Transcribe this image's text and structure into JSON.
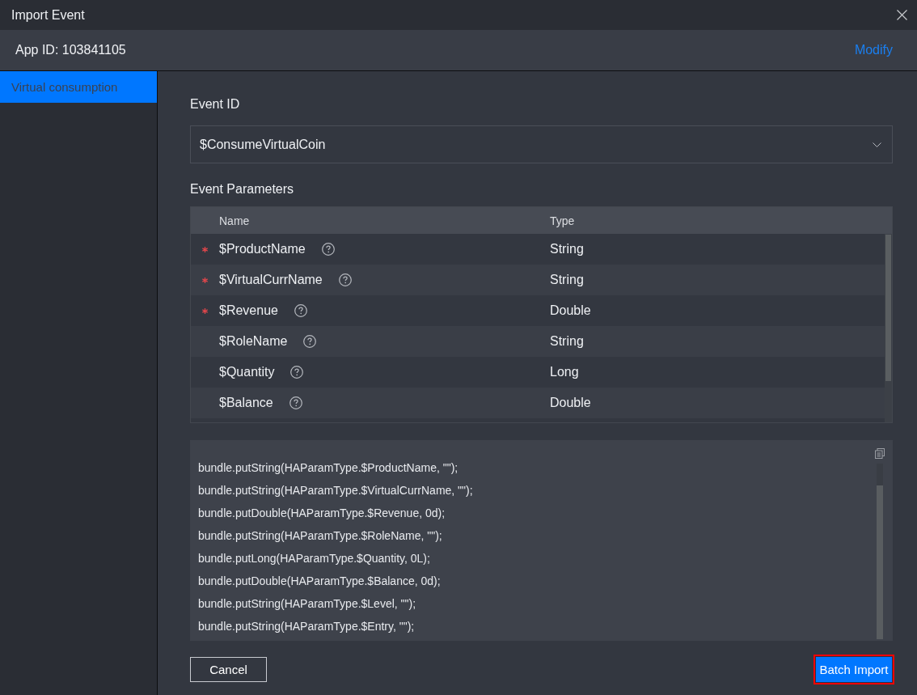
{
  "window": {
    "title": "Import Event"
  },
  "app_bar": {
    "app_id": "App ID: 103841105",
    "modify_link": "Modify"
  },
  "sidebar": {
    "items": [
      {
        "label": "Virtual consumption",
        "selected": true
      }
    ]
  },
  "event_id": {
    "label": "Event ID",
    "value": "$ConsumeVirtualCoin"
  },
  "parameters": {
    "label": "Event Parameters",
    "columns": [
      "Name",
      "Type"
    ],
    "rows": [
      {
        "name": "$ProductName",
        "type": "String",
        "required": true
      },
      {
        "name": "$VirtualCurrName",
        "type": "String",
        "required": true
      },
      {
        "name": "$Revenue",
        "type": "Double",
        "required": true
      },
      {
        "name": "$RoleName",
        "type": "String",
        "required": false
      },
      {
        "name": "$Quantity",
        "type": "Long",
        "required": false
      },
      {
        "name": "$Balance",
        "type": "Double",
        "required": false
      }
    ]
  },
  "code": {
    "lines": [
      "bundle.putString(HAParamType.$ProductName, \"\");",
      "bundle.putString(HAParamType.$VirtualCurrName, \"\");",
      "bundle.putDouble(HAParamType.$Revenue, 0d);",
      "bundle.putString(HAParamType.$RoleName, \"\");",
      "bundle.putLong(HAParamType.$Quantity, 0L);",
      "bundle.putDouble(HAParamType.$Balance, 0d);",
      "bundle.putString(HAParamType.$Level, \"\");",
      "bundle.putString(HAParamType.$Entry, \"\");"
    ]
  },
  "buttons": [
    {
      "label": "Cancel",
      "kind": "secondary",
      "highlighted": false
    },
    {
      "label": "Batch Import",
      "kind": "primary",
      "highlighted": true
    }
  ]
}
